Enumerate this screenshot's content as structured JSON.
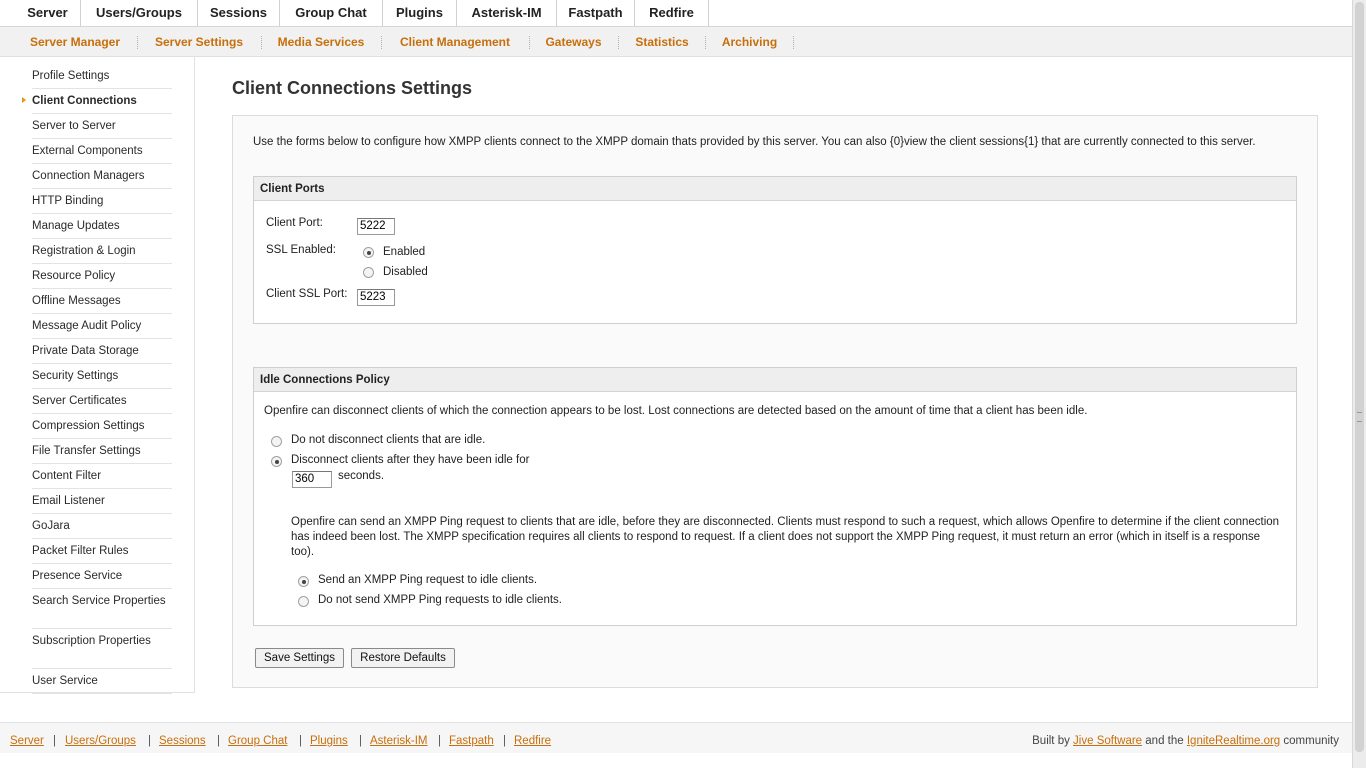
{
  "top_nav": [
    {
      "label": "Server",
      "active": true
    },
    {
      "label": "Users/Groups",
      "active": false
    },
    {
      "label": "Sessions",
      "active": false
    },
    {
      "label": "Group Chat",
      "active": false
    },
    {
      "label": "Plugins",
      "active": false
    },
    {
      "label": "Asterisk-IM",
      "active": false
    },
    {
      "label": "Fastpath",
      "active": false
    },
    {
      "label": "Redfire",
      "active": false
    }
  ],
  "sub_nav": [
    {
      "label": "Server Manager",
      "active": false
    },
    {
      "label": "Server Settings",
      "active": true
    },
    {
      "label": "Media Services",
      "active": false
    },
    {
      "label": "Client Management",
      "active": false
    },
    {
      "label": "Gateways",
      "active": false
    },
    {
      "label": "Statistics",
      "active": false
    },
    {
      "label": "Archiving",
      "active": false
    }
  ],
  "sidebar": {
    "active_index": 1,
    "items": [
      {
        "label": "Profile Settings"
      },
      {
        "label": "Client Connections"
      },
      {
        "label": "Server to Server"
      },
      {
        "label": "External Components"
      },
      {
        "label": "Connection Managers"
      },
      {
        "label": "HTTP Binding"
      },
      {
        "label": "Manage Updates"
      },
      {
        "label": "Registration & Login"
      },
      {
        "label": "Resource Policy"
      },
      {
        "label": "Offline Messages"
      },
      {
        "label": "Message Audit Policy"
      },
      {
        "label": "Private Data Storage"
      },
      {
        "label": "Security Settings"
      },
      {
        "label": "Server Certificates"
      },
      {
        "label": "Compression Settings"
      },
      {
        "label": "File Transfer Settings"
      },
      {
        "label": "Content Filter"
      },
      {
        "label": "Email Listener"
      },
      {
        "label": "GoJara"
      },
      {
        "label": "Packet Filter Rules"
      },
      {
        "label": "Presence Service"
      },
      {
        "label": "Search Service Properties"
      },
      {
        "label": "Subscription Properties"
      },
      {
        "label": "User Service"
      }
    ]
  },
  "page": {
    "title": "Client Connections Settings",
    "intro": "Use the forms below to configure how XMPP clients connect to the XMPP domain thats provided by this server. You can also {0}view the client sessions{1} that are currently connected to this server."
  },
  "client_ports": {
    "title": "Client Ports",
    "client_port_label": "Client Port:",
    "client_port_value": "5222",
    "ssl_label": "SSL Enabled:",
    "ssl_enabled_label": "Enabled",
    "ssl_disabled_label": "Disabled",
    "ssl_selected": "enabled",
    "ssl_port_label": "Client SSL Port:",
    "ssl_port_value": "5223"
  },
  "idle_policy": {
    "title": "Idle Connections Policy",
    "description": "Openfire can disconnect clients of which the connection appears to be lost. Lost connections are detected based on the amount of time that a client has been idle.",
    "no_disconnect_label": "Do not disconnect clients that are idle.",
    "disconnect_label": "Disconnect clients after they have been idle for",
    "selected": "disconnect",
    "idle_seconds_value": "360",
    "seconds_label": "seconds.",
    "ping_description": "Openfire can send an XMPP Ping request to clients that are idle, before they are disconnected. Clients must respond to such a request, which allows Openfire to determine if the client connection has indeed been lost. The XMPP specification requires all clients to respond to request. If a client does not support the XMPP Ping request, it must return an error (which in itself is a response too).",
    "ping_send_label": "Send an XMPP Ping request to idle clients.",
    "ping_nosend_label": "Do not send XMPP Ping requests to idle clients.",
    "ping_selected": "send"
  },
  "buttons": {
    "save": "Save Settings",
    "restore": "Restore Defaults"
  },
  "footer": {
    "links": [
      "Server",
      "Users/Groups",
      "Sessions",
      "Group Chat",
      "Plugins",
      "Asterisk-IM",
      "Fastpath",
      "Redfire"
    ],
    "separator": "|",
    "credit_prefix": "Built by",
    "credit_link1": "Jive Software",
    "credit_middle": "and the",
    "credit_link2": "IgniteRealtime.org",
    "credit_suffix": "community"
  },
  "colors": {
    "accent": "#f39a1e",
    "link": "#c76f0c"
  }
}
